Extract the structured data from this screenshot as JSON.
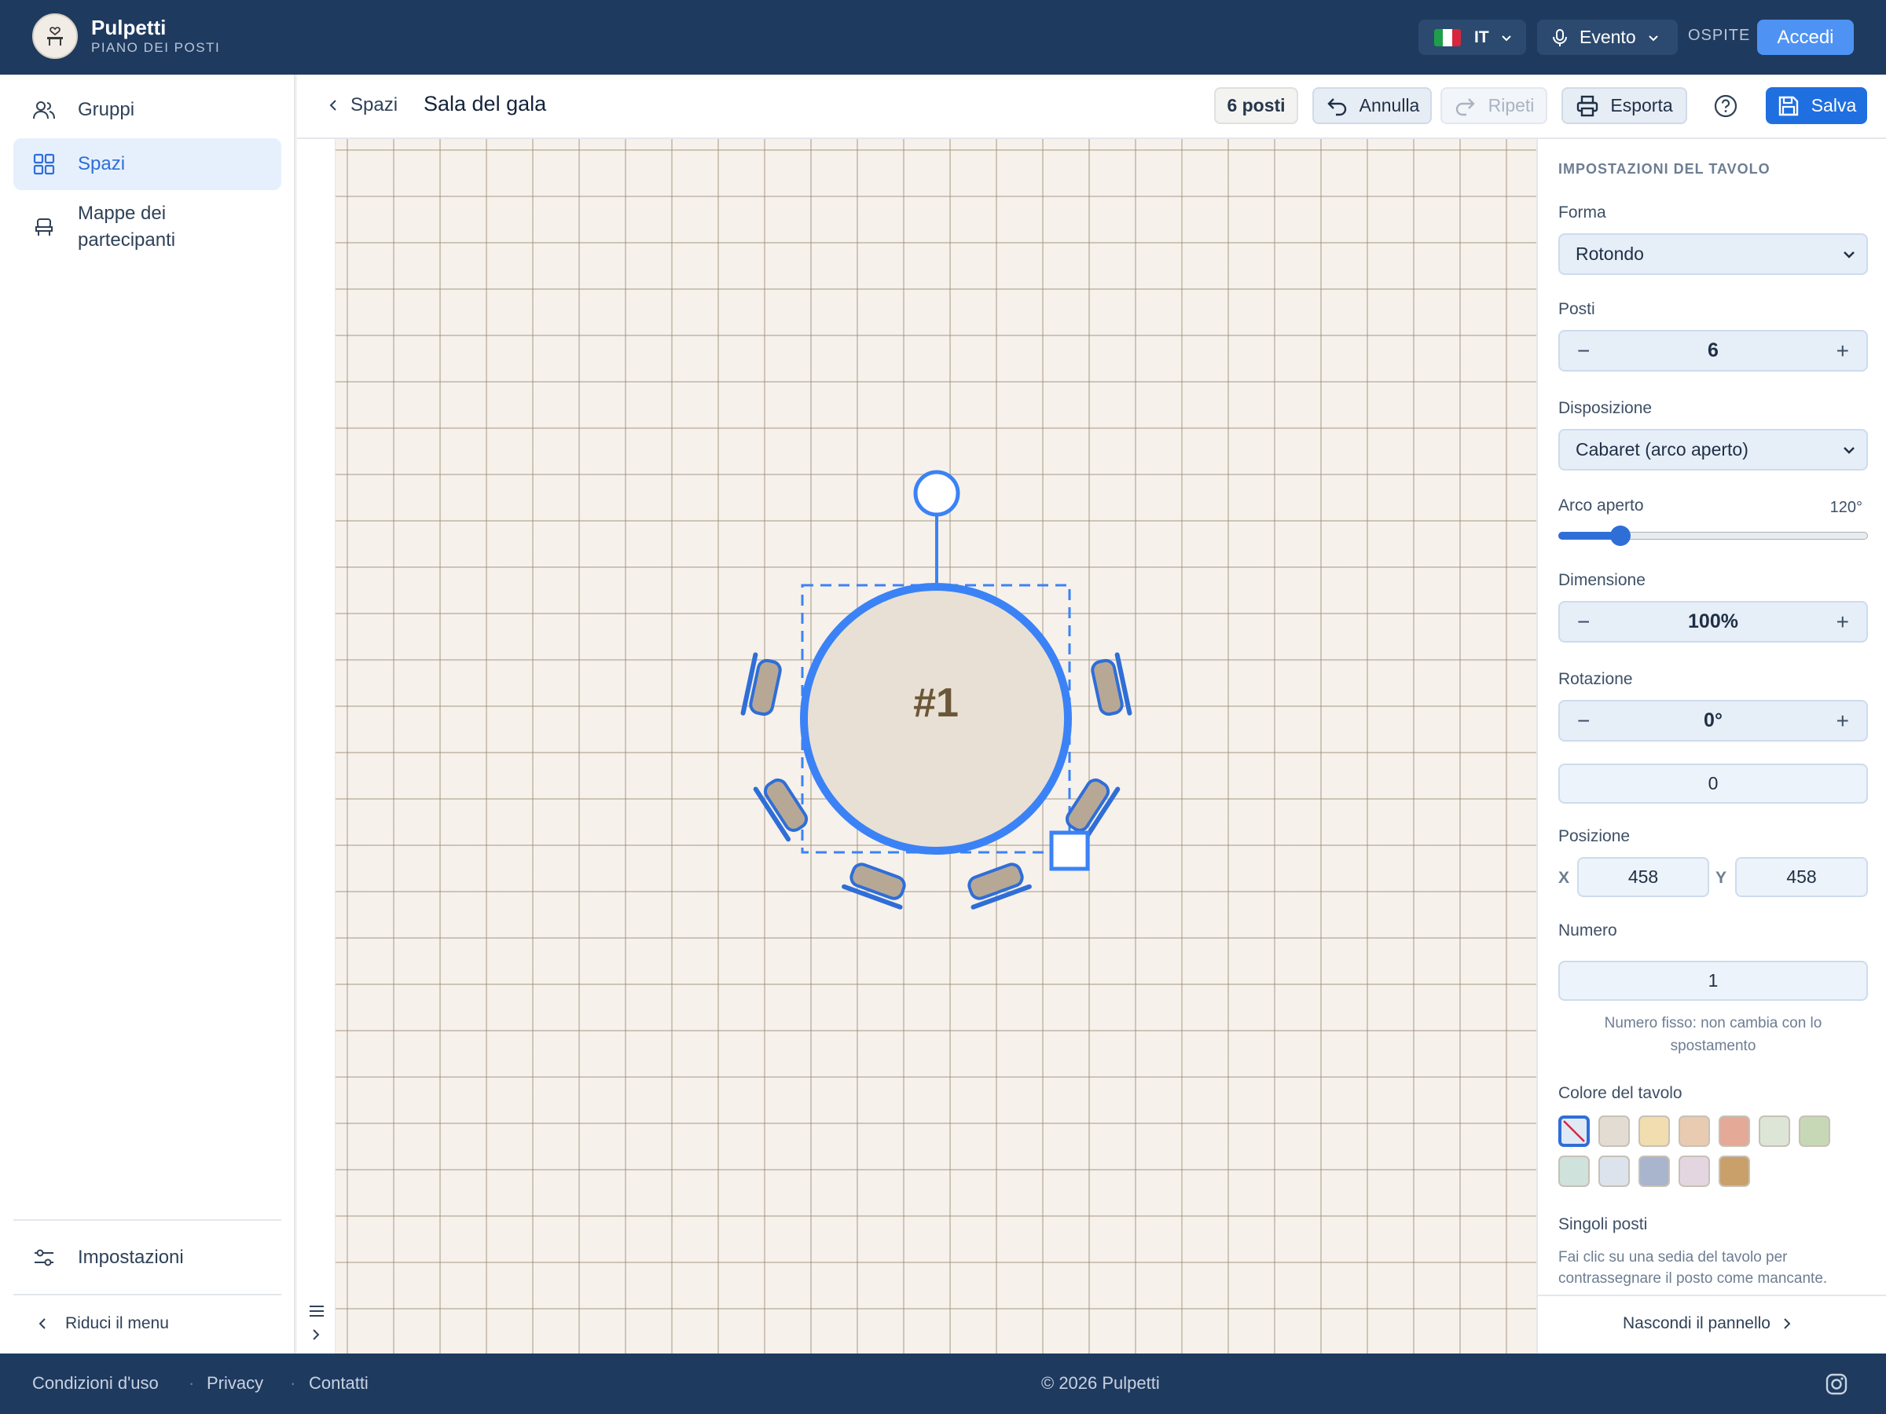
{
  "app": {
    "name": "Pulpetti",
    "subtitle": "PIANO DEI POSTI"
  },
  "header": {
    "language": "IT",
    "mode": "Evento",
    "guest_label": "OSPITE",
    "login": "Accedi",
    "flag_colors": [
      "#1e9e4a",
      "#ffffff",
      "#d7263d"
    ]
  },
  "sidebar": {
    "items": [
      {
        "label": "Gruppi",
        "icon": "users-icon"
      },
      {
        "label": "Spazi",
        "icon": "grid-icon",
        "active": true
      },
      {
        "label": "Mappe dei partecipanti",
        "icon": "seat-icon"
      }
    ],
    "settings": "Impostazioni",
    "collapse": "Riduci il menu"
  },
  "toolbar": {
    "back": "Spazi",
    "title": "Sala del gala",
    "seat_count": "6 posti",
    "undo": "Annulla",
    "redo": "Ripeti",
    "export": "Esporta",
    "save": "Salva"
  },
  "table": {
    "label": "#1",
    "seats": 6,
    "fill": "#e8e0d4",
    "accent": "#3b82f6"
  },
  "panel": {
    "heading": "IMPOSTAZIONI DEL TAVOLO",
    "shape_label": "Forma",
    "shape_value": "Rotondo",
    "seats_label": "Posti",
    "seats_value": "6",
    "layout_label": "Disposizione",
    "layout_value": "Cabaret (arco aperto)",
    "arc_label": "Arco aperto",
    "arc_value": "120°",
    "arc_fraction": 0.2,
    "size_label": "Dimensione",
    "size_value": "100%",
    "rotation_label": "Rotazione",
    "rotation_value": "0°",
    "rotation_input": "0",
    "position_label": "Posizione",
    "x_label": "X",
    "x_value": "458",
    "y_label": "Y",
    "y_value": "458",
    "number_label": "Numero",
    "number_value": "1",
    "number_hint": "Numero fisso: non cambia con lo spostamento",
    "color_label": "Colore del tavolo",
    "colors": [
      "none",
      "#e3dcd2",
      "#f1ddb0",
      "#e8cbb0",
      "#e4a997",
      "#dde6d6",
      "#c7d8b6",
      "#cfe2dc",
      "#dce3ec",
      "#a8b5cc",
      "#e4d6e1",
      "#c9a06a"
    ],
    "seats_section_label": "Singoli posti",
    "seats_section_hint": "Fai clic su una sedia del tavolo per contrassegnare il posto come mancante.",
    "hide_panel": "Nascondi il pannello"
  },
  "footer": {
    "terms": "Condizioni d'uso",
    "privacy": "Privacy",
    "contacts": "Contatti",
    "copyright": "© 2026 Pulpetti"
  }
}
